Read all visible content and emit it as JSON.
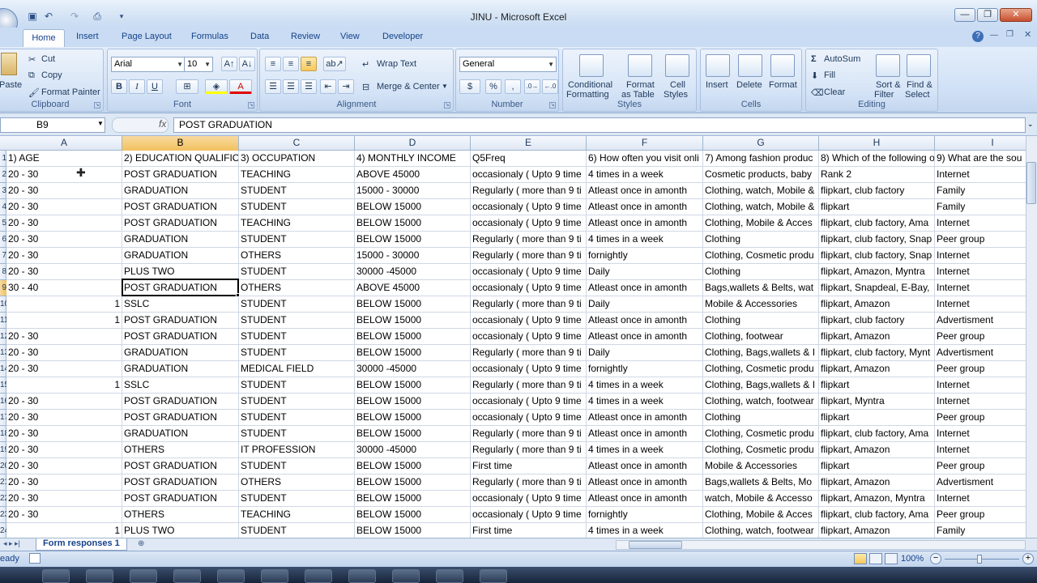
{
  "window": {
    "title": "JINU - Microsoft Excel",
    "minimize": "—",
    "restore": "❐",
    "close": "✕"
  },
  "tabs": [
    "Home",
    "Insert",
    "Page Layout",
    "Formulas",
    "Data",
    "Review",
    "View",
    "Developer"
  ],
  "ribbon": {
    "clipboard": {
      "label": "Clipboard",
      "paste": "Paste",
      "cut": "Cut",
      "copy": "Copy",
      "format_painter": "Format Painter"
    },
    "font": {
      "label": "Font",
      "name": "Arial",
      "size": "10",
      "bold": "B",
      "italic": "I",
      "underline": "U"
    },
    "alignment": {
      "label": "Alignment",
      "wrap": "Wrap Text",
      "merge": "Merge & Center"
    },
    "number": {
      "label": "Number",
      "format": "General",
      "currency": "$",
      "percent": "%",
      "comma": ","
    },
    "styles": {
      "label": "Styles",
      "conditional": [
        "Conditional",
        "Formatting"
      ],
      "format_table": [
        "Format",
        "as Table"
      ],
      "cell_styles": [
        "Cell",
        "Styles"
      ]
    },
    "cells": {
      "label": "Cells",
      "insert": "Insert",
      "delete": "Delete",
      "format": "Format"
    },
    "editing": {
      "label": "Editing",
      "autosum": "AutoSum",
      "fill": "Fill",
      "clear": "Clear",
      "sort": [
        "Sort &",
        "Filter"
      ],
      "find": [
        "Find &",
        "Select"
      ]
    }
  },
  "formula_bar": {
    "name_box": "B9",
    "fx": "fx",
    "content": "POST GRADUATION"
  },
  "columns": [
    "A",
    "B",
    "C",
    "D",
    "E",
    "F",
    "G",
    "H",
    "I"
  ],
  "row_numbers": [
    "1",
    "2",
    "3",
    "4",
    "5",
    "6",
    "7",
    "8",
    "9",
    "10",
    "11",
    "12",
    "13",
    "14",
    "15",
    "16",
    "17",
    "18",
    "19",
    "20",
    "21",
    "22",
    "23",
    "24"
  ],
  "rows": [
    [
      "1) AGE",
      "2) EDUCATION QUALIFIC",
      "3) OCCUPATION",
      "4) MONTHLY INCOME",
      "Q5Freq",
      "6) How often you visit onli",
      "7)  Among fashion produc",
      "8) Which of the following o",
      "9) What are the sou"
    ],
    [
      "20 - 30",
      "POST GRADUATION",
      "TEACHING",
      "ABOVE 45000",
      "occasionaly ( Upto 9 time",
      "4 times in a week",
      "Cosmetic products, baby",
      "Rank 2",
      "Internet"
    ],
    [
      "20 - 30",
      "GRADUATION",
      "STUDENT",
      "15000 - 30000",
      "Regularly ( more than 9 ti",
      "Atleast once in amonth",
      "Clothing, watch, Mobile &",
      "flipkart, club factory",
      "Family"
    ],
    [
      "20 - 30",
      "POST GRADUATION",
      "STUDENT",
      "BELOW 15000",
      "occasionaly ( Upto 9 time",
      "Atleast once in amonth",
      "Clothing, watch, Mobile &",
      "flipkart",
      "Family"
    ],
    [
      "20 - 30",
      "POST GRADUATION",
      "TEACHING",
      "BELOW 15000",
      "occasionaly ( Upto 9 time",
      "Atleast once in amonth",
      "Clothing, Mobile & Acces",
      "flipkart, club factory, Ama",
      "Internet"
    ],
    [
      "20 - 30",
      "GRADUATION",
      "STUDENT",
      "BELOW 15000",
      "Regularly ( more than 9 ti",
      "4 times in a week",
      "Clothing",
      "flipkart, club factory, Snap",
      "Peer group"
    ],
    [
      "20 - 30",
      "GRADUATION",
      "OTHERS",
      "15000 - 30000",
      "Regularly ( more than 9 ti",
      "fornightly",
      "Clothing, Cosmetic produ",
      "flipkart, club factory, Snap",
      "Internet"
    ],
    [
      "20 - 30",
      "PLUS TWO",
      "STUDENT",
      "30000 -45000",
      "occasionaly ( Upto 9 time",
      "Daily",
      "Clothing",
      "flipkart, Amazon, Myntra",
      "Internet"
    ],
    [
      "30 - 40",
      "POST GRADUATION",
      "OTHERS",
      "ABOVE 45000",
      "occasionaly ( Upto 9 time",
      "Atleast once in amonth",
      "Bags,wallets & Belts, wat",
      "flipkart, Snapdeal, E-Bay,",
      "Internet"
    ],
    [
      "1",
      "SSLC",
      "STUDENT",
      "BELOW 15000",
      "Regularly ( more than 9 ti",
      "Daily",
      "Mobile & Accessories",
      "flipkart, Amazon",
      "Internet"
    ],
    [
      "1",
      "POST GRADUATION",
      "STUDENT",
      "BELOW 15000",
      "occasionaly ( Upto 9 time",
      "Atleast once in amonth",
      "Clothing",
      "flipkart, club factory",
      "Advertisment"
    ],
    [
      "20 - 30",
      "POST GRADUATION",
      "STUDENT",
      "BELOW 15000",
      "occasionaly ( Upto 9 time",
      "Atleast once in amonth",
      "Clothing, footwear",
      "flipkart, Amazon",
      "Peer group"
    ],
    [
      "20 - 30",
      "GRADUATION",
      "STUDENT",
      "BELOW 15000",
      "Regularly ( more than 9 ti",
      "Daily",
      "Clothing, Bags,wallets & I",
      "flipkart, club factory, Mynt",
      "Advertisment"
    ],
    [
      "20 - 30",
      "GRADUATION",
      "MEDICAL FIELD",
      "30000 -45000",
      "occasionaly ( Upto 9 time",
      "fornightly",
      "Clothing, Cosmetic produ",
      "flipkart, Amazon",
      "Peer group"
    ],
    [
      "1",
      "SSLC",
      "STUDENT",
      "BELOW 15000",
      "Regularly ( more than 9 ti",
      "4 times in a week",
      "Clothing, Bags,wallets & I",
      "flipkart",
      "Internet"
    ],
    [
      "20 - 30",
      "POST GRADUATION",
      "STUDENT",
      "BELOW 15000",
      "occasionaly ( Upto 9 time",
      "4 times in a week",
      "Clothing, watch, footwear",
      "flipkart, Myntra",
      "Internet"
    ],
    [
      "20 - 30",
      "POST GRADUATION",
      "STUDENT",
      "BELOW 15000",
      "occasionaly ( Upto 9 time",
      "Atleast once in amonth",
      "Clothing",
      "flipkart",
      "Peer group"
    ],
    [
      "20 - 30",
      "GRADUATION",
      "STUDENT",
      "BELOW 15000",
      "Regularly ( more than 9 ti",
      "Atleast once in amonth",
      "Clothing, Cosmetic produ",
      "flipkart, club factory, Ama",
      "Internet"
    ],
    [
      "20 - 30",
      "OTHERS",
      "IT PROFESSION",
      "30000 -45000",
      "Regularly ( more than 9 ti",
      "4 times in a week",
      "Clothing, Cosmetic produ",
      "flipkart, Amazon",
      "Internet"
    ],
    [
      "20 - 30",
      "POST GRADUATION",
      "STUDENT",
      "BELOW 15000",
      "First time",
      "Atleast once in amonth",
      "Mobile & Accessories",
      "flipkart",
      "Peer group"
    ],
    [
      "20 - 30",
      "POST GRADUATION",
      "OTHERS",
      "BELOW 15000",
      "Regularly ( more than 9 ti",
      "Atleast once in amonth",
      "Bags,wallets & Belts, Mo",
      "flipkart, Amazon",
      "Advertisment"
    ],
    [
      "20 - 30",
      "POST GRADUATION",
      "STUDENT",
      "BELOW 15000",
      "occasionaly ( Upto 9 time",
      "Atleast once in amonth",
      "watch, Mobile & Accesso",
      "flipkart, Amazon, Myntra",
      "Internet"
    ],
    [
      "20 - 30",
      "OTHERS",
      "TEACHING",
      "BELOW 15000",
      "occasionaly ( Upto 9 time",
      "fornightly",
      "Clothing, Mobile & Acces",
      "flipkart, club factory, Ama",
      "Peer group"
    ],
    [
      "1",
      "PLUS TWO",
      "STUDENT",
      "BELOW 15000",
      "First time",
      "4 times in a week",
      "Clothing, watch, footwear",
      "flipkart, Amazon",
      "Family"
    ]
  ],
  "sheet_tab": "Form responses 1",
  "status": {
    "ready": "eady",
    "zoom": "100%"
  },
  "colors": {
    "selected_header": "#f1c15f",
    "ribbon_text": "#15428b",
    "gridline": "#d0d7e5"
  }
}
